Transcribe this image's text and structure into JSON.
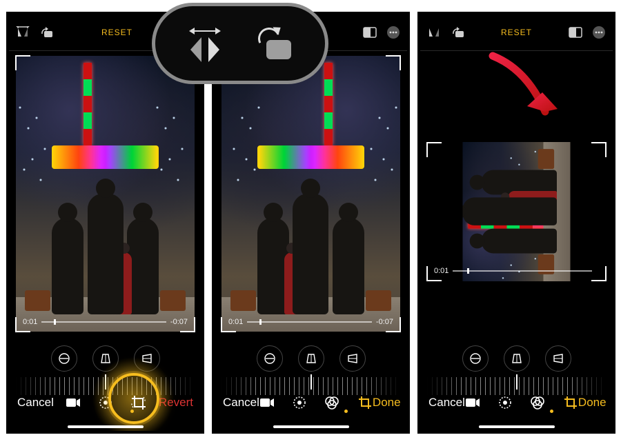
{
  "meta": {
    "description": "iOS Photos app — video crop/rotate editor, three-step tutorial",
    "device_frame_count": 3
  },
  "common": {
    "reset_label": "RESET",
    "cancel_label": "Cancel",
    "done_label": "Done",
    "revert_label": "Revert",
    "scrubber": {
      "elapsed": "0:01",
      "remaining": "-0:07"
    },
    "home_indicator": true
  },
  "icons": {
    "flip_horizontal": "flip-horizontal-icon",
    "rotate_90": "rotate-90-icon",
    "aspect_ratio": "aspect-ratio-icon",
    "more": "more-icon",
    "straighten": "straighten-icon",
    "vertical_perspective": "vertical-perspective-icon",
    "horizontal_perspective": "horizontal-perspective-icon",
    "video_mode": "video-mode-icon",
    "adjust_mode": "adjust-mode-icon",
    "filters_mode": "filters-mode-icon",
    "crop_mode": "crop-mode-icon"
  },
  "callout": {
    "buttons": [
      "flip-horizontal",
      "rotate-90"
    ]
  },
  "screens": [
    {
      "id": "step1",
      "top_right_buttons": [
        "aspect-ratio"
      ],
      "bottom_tools": [
        "video",
        "adjust",
        "crop"
      ],
      "crop_selected": true,
      "trailing_action": "revert",
      "highlight_crop_tool": true,
      "photo_transform": "none"
    },
    {
      "id": "step2",
      "top_right_buttons": [
        "aspect-ratio",
        "more"
      ],
      "bottom_tools": [
        "video",
        "adjust",
        "filters",
        "crop"
      ],
      "crop_selected": true,
      "trailing_action": "done",
      "photo_transform": "mirror"
    },
    {
      "id": "step3",
      "top_right_buttons": [
        "aspect-ratio",
        "more"
      ],
      "bottom_tools": [
        "video",
        "adjust",
        "filters",
        "crop"
      ],
      "crop_selected": true,
      "trailing_action": "done",
      "photo_transform": "rotate-90-ccw",
      "annotation": "red-arrow-to-rotated-frame"
    }
  ]
}
